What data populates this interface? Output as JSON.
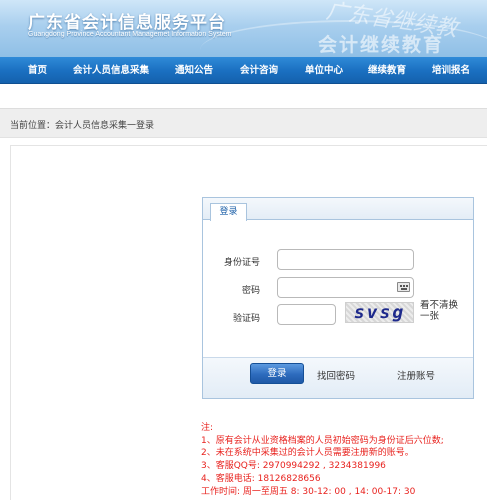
{
  "header": {
    "title": "广东省会计信息服务平台",
    "subtitle": "Guangdong Province Accountant Managemet Information System",
    "slogan_top": "广东省继续教",
    "slogan_bottom": "会计继续教育"
  },
  "nav": {
    "items": [
      "首页",
      "会计人员信息采集",
      "通知公告",
      "会计咨询",
      "单位中心",
      "继续教育",
      "培训报名"
    ]
  },
  "breadcrumb": "当前位置：会计人员信息采集一登录",
  "login": {
    "tab_label": "登录",
    "id_label": "身份证号",
    "id_value": "",
    "password_label": "密码",
    "password_value": "",
    "captcha_label": "验证码",
    "captcha_value": "",
    "captcha_text": "svsg",
    "refresh_text": "看不清换一张",
    "login_button": "登录",
    "forgot_link": "找回密码",
    "register_link": "注册账号"
  },
  "notes": {
    "heading": "注:",
    "lines": [
      "1、原有会计从业资格档案的人员初始密码为身份证后六位数;",
      "2、未在系统中采集过的会计人员需要注册新的账号。",
      "3、客服QQ号: 2970994292 , 3234381996",
      "4、客服电话: 18126828656",
      "工作时间: 周一至周五 8: 30-12: 00 , 14: 00-17: 30"
    ]
  },
  "colors": {
    "nav_blue": "#1a6fc0",
    "accent_blue": "#2d6bbd",
    "note_red": "#e8221e"
  }
}
